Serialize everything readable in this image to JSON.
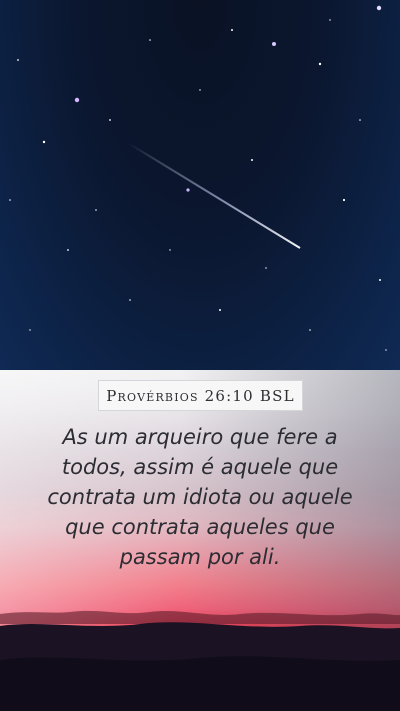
{
  "reference": "Provérbios 26:10 BSL",
  "verse_text": "As um arqueiro que fere a todos, assim é aquele que contrata um idiota ou aquele que contrata aqueles que passam por ali.",
  "colors": {
    "sky_top": "#0a1224",
    "sky_bottom": "#0f2a55",
    "sunset_light": "#f2f2f3",
    "sunset_red": "#e83b4f",
    "ground_dark": "#140f1f",
    "verse_text": "#2c2c33"
  }
}
